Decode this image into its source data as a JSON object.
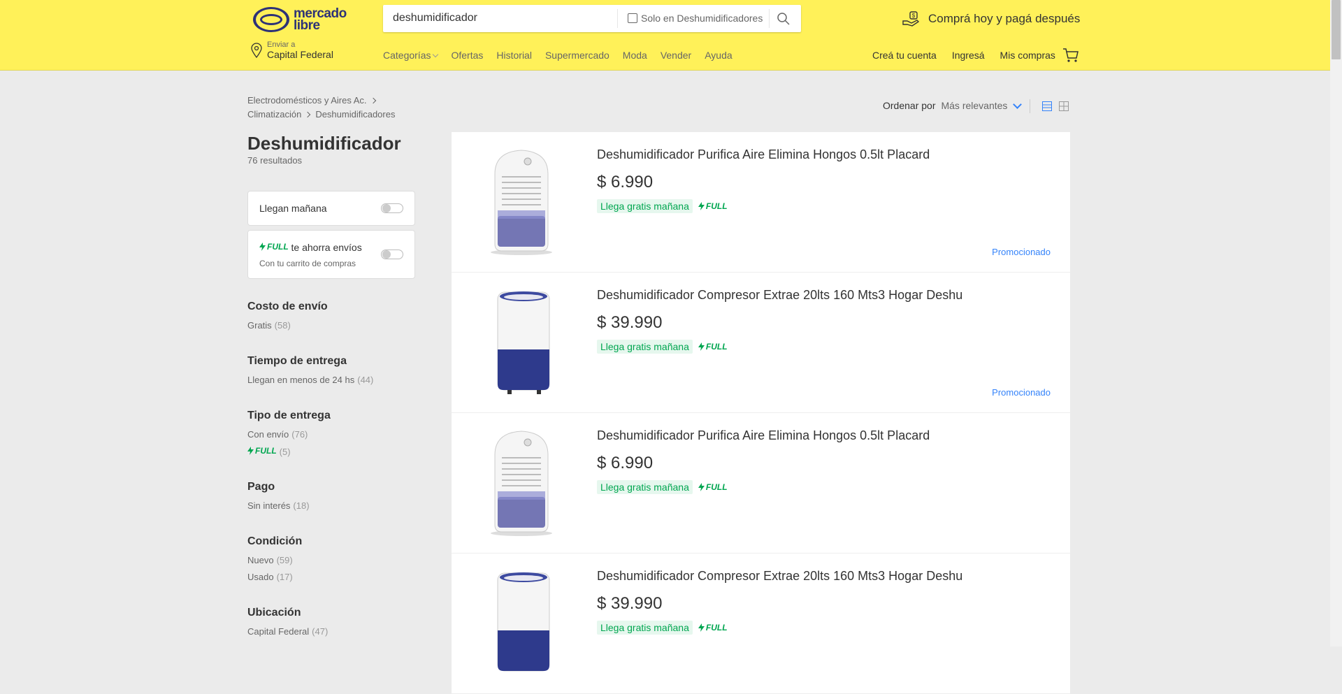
{
  "header": {
    "logo_line1": "mercado",
    "logo_line2": "libre",
    "search": {
      "value": "deshumidificador",
      "only_category_label": "Solo en Deshumidificadores"
    },
    "promo_text": "Comprá hoy y pagá después",
    "location": {
      "label": "Enviar a",
      "value": "Capital Federal"
    },
    "nav": [
      "Categorías",
      "Ofertas",
      "Historial",
      "Supermercado",
      "Moda",
      "Vender",
      "Ayuda"
    ],
    "user_nav": [
      "Creá tu cuenta",
      "Ingresá",
      "Mis compras"
    ]
  },
  "breadcrumb": [
    "Electrodomésticos y Aires Ac.",
    "Climatización",
    "Deshumidificadores"
  ],
  "page": {
    "title": "Deshumidificador",
    "results": "76 resultados"
  },
  "quick_filters": {
    "tomorrow_label": "Llegan mañana",
    "full_badge": "FULL",
    "full_text": "te ahorra envíos",
    "full_sub": "Con tu carrito de compras"
  },
  "filters": [
    {
      "title": "Costo de envío",
      "items": [
        {
          "label": "Gratis",
          "count": "(58)"
        }
      ]
    },
    {
      "title": "Tiempo de entrega",
      "items": [
        {
          "label": "Llegan en menos de 24 hs",
          "count": "(44)"
        }
      ]
    },
    {
      "title": "Tipo de entrega",
      "items": [
        {
          "label": "Con envío",
          "count": "(76)"
        },
        {
          "label": "FULL",
          "count": "(5)",
          "is_full": true
        }
      ]
    },
    {
      "title": "Pago",
      "items": [
        {
          "label": "Sin interés",
          "count": "(18)"
        }
      ]
    },
    {
      "title": "Condición",
      "items": [
        {
          "label": "Nuevo",
          "count": "(59)"
        },
        {
          "label": "Usado",
          "count": "(17)"
        }
      ]
    },
    {
      "title": "Ubicación",
      "items": [
        {
          "label": "Capital Federal",
          "count": "(47)"
        }
      ]
    }
  ],
  "sort": {
    "label": "Ordenar por",
    "value": "Más relevantes"
  },
  "items": [
    {
      "title": "Deshumidificador Purifica Aire Elimina Hongos 0.5lt Placard",
      "price": "$ 6.990",
      "shipping": "Llega gratis mañana",
      "full": "FULL",
      "promoted": "Promocionado",
      "image": "small-dehumidifier"
    },
    {
      "title": "Deshumidificador Compresor Extrae 20lts 160 Mts3 Hogar Deshu",
      "price": "$ 39.990",
      "shipping": "Llega gratis mañana",
      "full": "FULL",
      "promoted": "Promocionado",
      "image": "tall-dehumidifier"
    },
    {
      "title": "Deshumidificador Purifica Aire Elimina Hongos 0.5lt Placard",
      "price": "$ 6.990",
      "shipping": "Llega gratis mañana",
      "full": "FULL",
      "promoted": "",
      "image": "small-dehumidifier"
    },
    {
      "title": "Deshumidificador Compresor Extrae 20lts 160 Mts3 Hogar Deshu",
      "price": "$ 39.990",
      "shipping": "Llega gratis mañana",
      "full": "FULL",
      "promoted": "",
      "image": "tall-dehumidifier"
    }
  ],
  "colors": {
    "header_bg": "#fff159",
    "accent_blue": "#3483fa",
    "full_green": "#00a650"
  }
}
